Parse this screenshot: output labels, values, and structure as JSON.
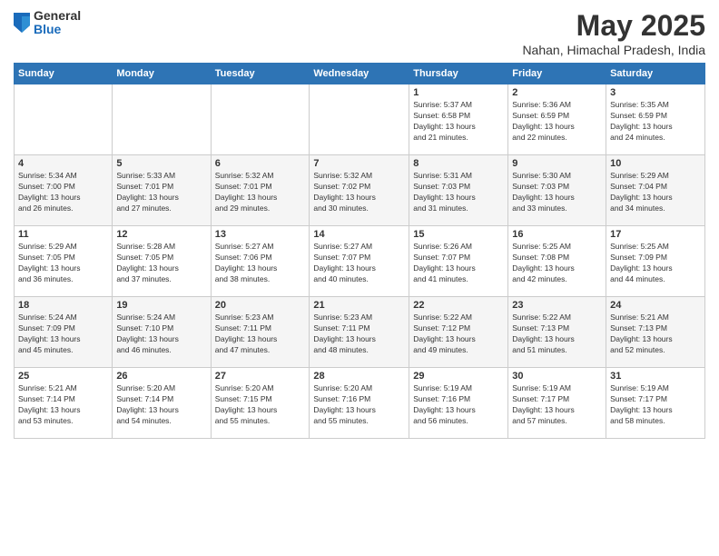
{
  "logo": {
    "general": "General",
    "blue": "Blue"
  },
  "title": "May 2025",
  "subtitle": "Nahan, Himachal Pradesh, India",
  "days_of_week": [
    "Sunday",
    "Monday",
    "Tuesday",
    "Wednesday",
    "Thursday",
    "Friday",
    "Saturday"
  ],
  "weeks": [
    [
      {
        "day": "",
        "info": ""
      },
      {
        "day": "",
        "info": ""
      },
      {
        "day": "",
        "info": ""
      },
      {
        "day": "",
        "info": ""
      },
      {
        "day": "1",
        "info": "Sunrise: 5:37 AM\nSunset: 6:58 PM\nDaylight: 13 hours\nand 21 minutes."
      },
      {
        "day": "2",
        "info": "Sunrise: 5:36 AM\nSunset: 6:59 PM\nDaylight: 13 hours\nand 22 minutes."
      },
      {
        "day": "3",
        "info": "Sunrise: 5:35 AM\nSunset: 6:59 PM\nDaylight: 13 hours\nand 24 minutes."
      }
    ],
    [
      {
        "day": "4",
        "info": "Sunrise: 5:34 AM\nSunset: 7:00 PM\nDaylight: 13 hours\nand 26 minutes."
      },
      {
        "day": "5",
        "info": "Sunrise: 5:33 AM\nSunset: 7:01 PM\nDaylight: 13 hours\nand 27 minutes."
      },
      {
        "day": "6",
        "info": "Sunrise: 5:32 AM\nSunset: 7:01 PM\nDaylight: 13 hours\nand 29 minutes."
      },
      {
        "day": "7",
        "info": "Sunrise: 5:32 AM\nSunset: 7:02 PM\nDaylight: 13 hours\nand 30 minutes."
      },
      {
        "day": "8",
        "info": "Sunrise: 5:31 AM\nSunset: 7:03 PM\nDaylight: 13 hours\nand 31 minutes."
      },
      {
        "day": "9",
        "info": "Sunrise: 5:30 AM\nSunset: 7:03 PM\nDaylight: 13 hours\nand 33 minutes."
      },
      {
        "day": "10",
        "info": "Sunrise: 5:29 AM\nSunset: 7:04 PM\nDaylight: 13 hours\nand 34 minutes."
      }
    ],
    [
      {
        "day": "11",
        "info": "Sunrise: 5:29 AM\nSunset: 7:05 PM\nDaylight: 13 hours\nand 36 minutes."
      },
      {
        "day": "12",
        "info": "Sunrise: 5:28 AM\nSunset: 7:05 PM\nDaylight: 13 hours\nand 37 minutes."
      },
      {
        "day": "13",
        "info": "Sunrise: 5:27 AM\nSunset: 7:06 PM\nDaylight: 13 hours\nand 38 minutes."
      },
      {
        "day": "14",
        "info": "Sunrise: 5:27 AM\nSunset: 7:07 PM\nDaylight: 13 hours\nand 40 minutes."
      },
      {
        "day": "15",
        "info": "Sunrise: 5:26 AM\nSunset: 7:07 PM\nDaylight: 13 hours\nand 41 minutes."
      },
      {
        "day": "16",
        "info": "Sunrise: 5:25 AM\nSunset: 7:08 PM\nDaylight: 13 hours\nand 42 minutes."
      },
      {
        "day": "17",
        "info": "Sunrise: 5:25 AM\nSunset: 7:09 PM\nDaylight: 13 hours\nand 44 minutes."
      }
    ],
    [
      {
        "day": "18",
        "info": "Sunrise: 5:24 AM\nSunset: 7:09 PM\nDaylight: 13 hours\nand 45 minutes."
      },
      {
        "day": "19",
        "info": "Sunrise: 5:24 AM\nSunset: 7:10 PM\nDaylight: 13 hours\nand 46 minutes."
      },
      {
        "day": "20",
        "info": "Sunrise: 5:23 AM\nSunset: 7:11 PM\nDaylight: 13 hours\nand 47 minutes."
      },
      {
        "day": "21",
        "info": "Sunrise: 5:23 AM\nSunset: 7:11 PM\nDaylight: 13 hours\nand 48 minutes."
      },
      {
        "day": "22",
        "info": "Sunrise: 5:22 AM\nSunset: 7:12 PM\nDaylight: 13 hours\nand 49 minutes."
      },
      {
        "day": "23",
        "info": "Sunrise: 5:22 AM\nSunset: 7:13 PM\nDaylight: 13 hours\nand 51 minutes."
      },
      {
        "day": "24",
        "info": "Sunrise: 5:21 AM\nSunset: 7:13 PM\nDaylight: 13 hours\nand 52 minutes."
      }
    ],
    [
      {
        "day": "25",
        "info": "Sunrise: 5:21 AM\nSunset: 7:14 PM\nDaylight: 13 hours\nand 53 minutes."
      },
      {
        "day": "26",
        "info": "Sunrise: 5:20 AM\nSunset: 7:14 PM\nDaylight: 13 hours\nand 54 minutes."
      },
      {
        "day": "27",
        "info": "Sunrise: 5:20 AM\nSunset: 7:15 PM\nDaylight: 13 hours\nand 55 minutes."
      },
      {
        "day": "28",
        "info": "Sunrise: 5:20 AM\nSunset: 7:16 PM\nDaylight: 13 hours\nand 55 minutes."
      },
      {
        "day": "29",
        "info": "Sunrise: 5:19 AM\nSunset: 7:16 PM\nDaylight: 13 hours\nand 56 minutes."
      },
      {
        "day": "30",
        "info": "Sunrise: 5:19 AM\nSunset: 7:17 PM\nDaylight: 13 hours\nand 57 minutes."
      },
      {
        "day": "31",
        "info": "Sunrise: 5:19 AM\nSunset: 7:17 PM\nDaylight: 13 hours\nand 58 minutes."
      }
    ]
  ]
}
